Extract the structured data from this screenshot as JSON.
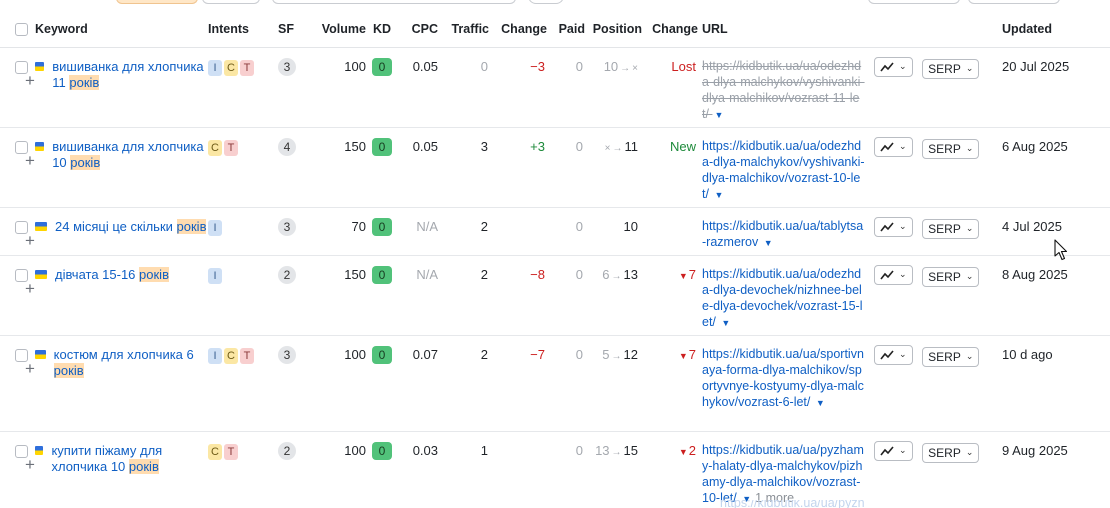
{
  "columns": {
    "keyword": "Keyword",
    "intents": "Intents",
    "sf": "SF",
    "volume": "Volume",
    "kd": "KD",
    "cpc": "CPC",
    "traffic": "Traffic",
    "change": "Change",
    "paid": "Paid",
    "position": "Position",
    "pos_change": "Change",
    "url": "URL",
    "updated": "Updated"
  },
  "serp_label": "SERP",
  "colors": {
    "link": "#0f5fc4",
    "kd_green": "#51c27a",
    "negative": "#cc1f1f",
    "positive": "#1d8a3a"
  },
  "rows": [
    {
      "kw_main": "вишиванка для хлопчика 11 ",
      "kw_hl": "років",
      "intents": [
        "I",
        "C",
        "T"
      ],
      "sf": "3",
      "volume": "100",
      "kd": "0",
      "cpc": "0.05",
      "traffic": "0",
      "change": "−3",
      "paid": "0",
      "pos_from": "10",
      "pos_to": "×",
      "pos_change": "Lost",
      "url": "https://kidbutik.ua/ua/odezhda-dlya-malchykov/vyshivanki-dlya-malchikov/vozrast-11-let/",
      "url_more": "",
      "updated": "20 Jul 2025"
    },
    {
      "kw_main": "вишиванка для хлопчика 10 ",
      "kw_hl": "років",
      "intents": [
        "C",
        "T"
      ],
      "sf": "4",
      "volume": "150",
      "kd": "0",
      "cpc": "0.05",
      "traffic": "3",
      "change": "+3",
      "paid": "0",
      "pos_from": "×",
      "pos_to": "11",
      "pos_change": "New",
      "url": "https://kidbutik.ua/ua/odezhda-dlya-malchykov/vyshivanki-dlya-malchikov/vozrast-10-let/",
      "url_more": "",
      "updated": "6 Aug 2025"
    },
    {
      "kw_main": "24 місяці це скільки ",
      "kw_hl": "років",
      "intents": [
        "I"
      ],
      "sf": "3",
      "volume": "70",
      "kd": "0",
      "cpc": "N/A",
      "traffic": "2",
      "change": "",
      "paid": "0",
      "pos_from": "",
      "pos_to": "10",
      "pos_change": "",
      "url": "https://kidbutik.ua/ua/tablytsa-razmerov",
      "url_more": "",
      "updated": "4 Jul 2025"
    },
    {
      "kw_main": "дівчата 15-16 ",
      "kw_hl": "років",
      "intents": [
        "I"
      ],
      "sf": "2",
      "volume": "150",
      "kd": "0",
      "cpc": "N/A",
      "traffic": "2",
      "change": "−8",
      "paid": "0",
      "pos_from": "6",
      "pos_to": "13",
      "pos_change": "7",
      "url": "https://kidbutik.ua/ua/odezhda-dlya-devochek/nizhnee-bele-dlya-devochek/vozrast-15-let/",
      "url_more": "",
      "updated": "8 Aug 2025"
    },
    {
      "kw_main": "костюм для хлопчика 6 ",
      "kw_hl": "років",
      "intents": [
        "I",
        "C",
        "T"
      ],
      "sf": "3",
      "volume": "100",
      "kd": "0",
      "cpc": "0.07",
      "traffic": "2",
      "change": "−7",
      "paid": "0",
      "pos_from": "5",
      "pos_to": "12",
      "pos_change": "7",
      "url": "https://kidbutik.ua/ua/sportivnaya-forma-dlya-malchikov/sportyvnye-kostyumy-dlya-malchykov/vozrast-6-let/",
      "url_more": "",
      "updated": "10 d ago"
    },
    {
      "kw_main": "купити піжаму для хлопчика 10 ",
      "kw_hl": "років",
      "intents": [
        "C",
        "T"
      ],
      "sf": "2",
      "volume": "100",
      "kd": "0",
      "cpc": "0.03",
      "traffic": "1",
      "change": "",
      "paid": "0",
      "pos_from": "13",
      "pos_to": "15",
      "pos_change": "2",
      "url": "https://kidbutik.ua/ua/pyzhamy-halaty-dlya-malchykov/pizhamy-dlya-malchikov/vozrast-10-let/",
      "url_more": "1 more",
      "updated": "9 Aug 2025"
    }
  ]
}
